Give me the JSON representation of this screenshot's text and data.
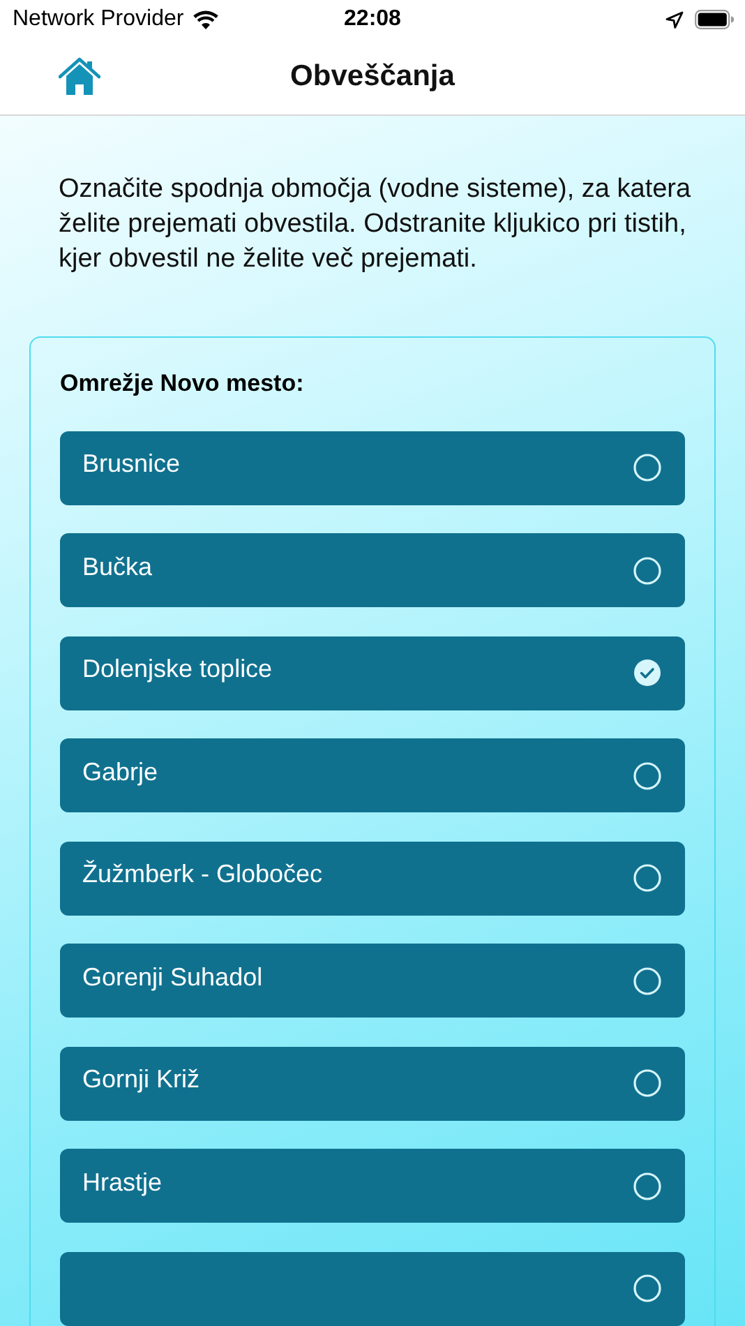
{
  "status_bar": {
    "carrier": "Network Provider",
    "time": "22:08"
  },
  "nav_bar": {
    "title": "Obveščanja"
  },
  "intro": "Označite spodnja območja (vodne sisteme), za katera želite prejemati obvestila. Odstranite kljukico pri tistih, kjer obvestil ne želite več prejemati.",
  "group": {
    "title": "Omrežje Novo mesto:",
    "items": [
      {
        "label": "Brusnice",
        "checked": false
      },
      {
        "label": "Bučka",
        "checked": false
      },
      {
        "label": "Dolenjske toplice",
        "checked": true
      },
      {
        "label": "Gabrje",
        "checked": false
      },
      {
        "label": "Žužmberk - Globočec",
        "checked": false
      },
      {
        "label": "Gorenji Suhadol",
        "checked": false
      },
      {
        "label": "Gornji Križ",
        "checked": false
      },
      {
        "label": "Hrastje",
        "checked": false
      }
    ],
    "partial_row": {
      "checked": false
    }
  }
}
